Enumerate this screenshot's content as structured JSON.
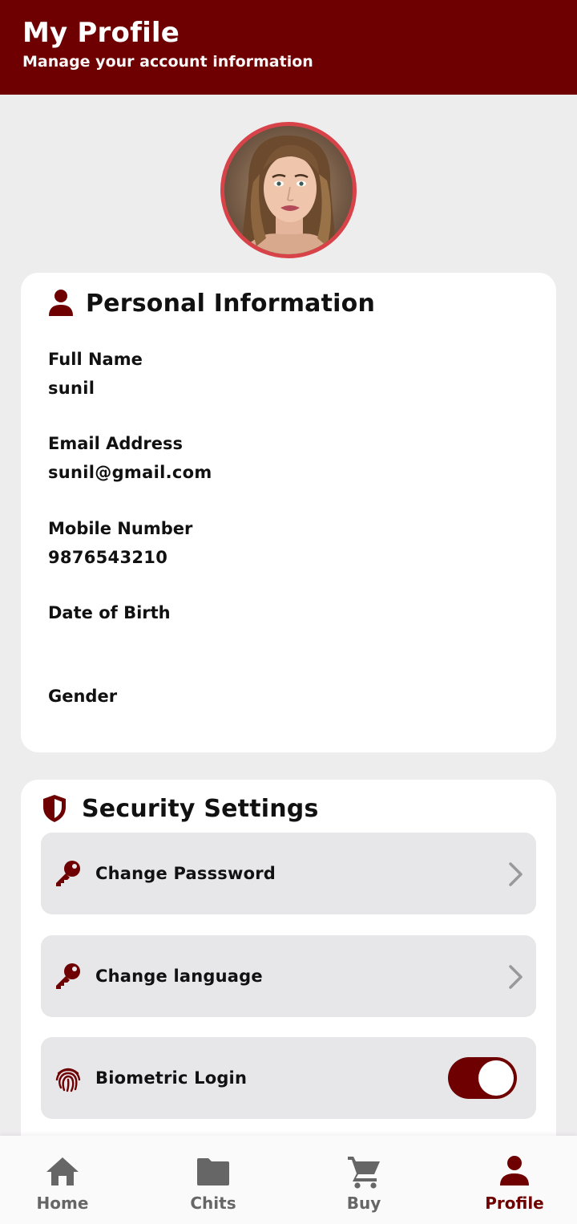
{
  "header": {
    "title": "My Profile",
    "subtitle": "Manage your account information"
  },
  "personal": {
    "heading": "Personal Information",
    "fields": [
      {
        "label": "Full Name",
        "value": "sunil"
      },
      {
        "label": "Email Address",
        "value": "sunil@gmail.com"
      },
      {
        "label": "Mobile Number",
        "value": "9876543210"
      },
      {
        "label": "Date of Birth",
        "value": ""
      },
      {
        "label": "Gender",
        "value": ""
      }
    ]
  },
  "security": {
    "heading": "Security Settings",
    "rows": [
      {
        "label": "Change Passsword",
        "icon": "key-icon"
      },
      {
        "label": "Change language",
        "icon": "key-icon"
      },
      {
        "label": "Biometric Login",
        "icon": "fingerprint-icon",
        "toggle_on": true
      }
    ]
  },
  "nav": {
    "items": [
      {
        "label": "Home",
        "icon": "home-icon",
        "active": false
      },
      {
        "label": "Chits",
        "icon": "folder-icon",
        "active": false
      },
      {
        "label": "Buy",
        "icon": "cart-icon",
        "active": false
      },
      {
        "label": "Profile",
        "icon": "person-icon",
        "active": true
      }
    ]
  },
  "colors": {
    "primary": "#6e0002",
    "background": "#eeedee",
    "row_background": "#e7e7ea",
    "avatar_ring": "#d8434a",
    "nav_inactive": "#666666"
  }
}
